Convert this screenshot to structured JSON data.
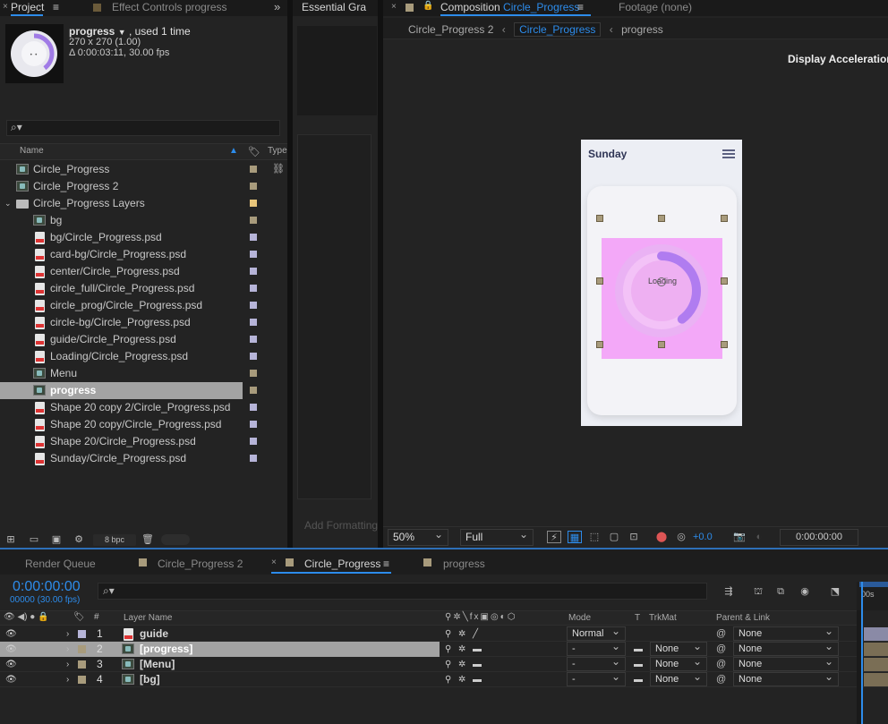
{
  "colors": {
    "accent": "#2d8ceb",
    "bg": "#1c1c1c",
    "panel": "#232323",
    "selection": "#a3a3a3",
    "magenta_layer": "#f3a8f8",
    "progress_arc": "#b07cf0"
  },
  "project_panel": {
    "tab_project": "Project",
    "tab_effect_controls": "Effect Controls progress",
    "item_name": "progress",
    "item_used": ", used 1 time",
    "item_dims": "270 x 270 (1.00)",
    "item_duration": "Δ 0:00:03:11, 30.00 fps",
    "search_placeholder": "",
    "col_name": "Name",
    "col_type": "Type",
    "items": [
      {
        "name": "Circle_Progress",
        "icon": "comp-icon",
        "indent": 0,
        "swatch": "#a89b7c"
      },
      {
        "name": "Circle_Progress 2",
        "icon": "comp-icon",
        "indent": 0,
        "swatch": "#a89b7c"
      },
      {
        "name": "Circle_Progress Layers",
        "icon": "folder-icon",
        "indent": 0,
        "swatch": "#e8c57a"
      },
      {
        "name": "bg",
        "icon": "comp-icon",
        "indent": 1,
        "swatch": "#a89b7c"
      },
      {
        "name": "bg/Circle_Progress.psd",
        "icon": "psd-icon",
        "indent": 1,
        "swatch": "#b6b4d8"
      },
      {
        "name": "card-bg/Circle_Progress.psd",
        "icon": "psd-icon",
        "indent": 1,
        "swatch": "#b6b4d8"
      },
      {
        "name": "center/Circle_Progress.psd",
        "icon": "psd-icon",
        "indent": 1,
        "swatch": "#b6b4d8"
      },
      {
        "name": "circle_full/Circle_Progress.psd",
        "icon": "psd-icon",
        "indent": 1,
        "swatch": "#b6b4d8"
      },
      {
        "name": "circle_prog/Circle_Progress.psd",
        "icon": "psd-icon",
        "indent": 1,
        "swatch": "#b6b4d8"
      },
      {
        "name": "circle-bg/Circle_Progress.psd",
        "icon": "psd-icon",
        "indent": 1,
        "swatch": "#b6b4d8"
      },
      {
        "name": "guide/Circle_Progress.psd",
        "icon": "psd-icon",
        "indent": 1,
        "swatch": "#b6b4d8"
      },
      {
        "name": "Loading/Circle_Progress.psd",
        "icon": "psd-icon",
        "indent": 1,
        "swatch": "#b6b4d8"
      },
      {
        "name": "Menu",
        "icon": "comp-icon",
        "indent": 1,
        "swatch": "#a89b7c"
      },
      {
        "name": "progress",
        "icon": "comp-icon",
        "indent": 1,
        "swatch": "#a89b7c",
        "selected": true
      },
      {
        "name": "Shape 20 copy 2/Circle_Progress.psd",
        "icon": "psd-icon",
        "indent": 1,
        "swatch": "#b6b4d8"
      },
      {
        "name": "Shape 20 copy/Circle_Progress.psd",
        "icon": "psd-icon",
        "indent": 1,
        "swatch": "#b6b4d8"
      },
      {
        "name": "Shape 20/Circle_Progress.psd",
        "icon": "psd-icon",
        "indent": 1,
        "swatch": "#b6b4d8"
      },
      {
        "name": "Sunday/Circle_Progress.psd",
        "icon": "psd-icon",
        "indent": 1,
        "swatch": "#b6b4d8"
      }
    ],
    "bpc": "8 bpc"
  },
  "essential_graphics": {
    "tab": "Essential Gra",
    "add_formatting": "Add Formatting"
  },
  "composition_panel": {
    "tab_prefix": "Composition",
    "tab_name": "Circle_Progress",
    "tab_footage": "Footage (none)",
    "breadcrumbs": [
      "Circle_Progress 2",
      "Circle_Progress",
      "progress"
    ],
    "display_accel": "Display Acceleration D",
    "preview_title": "Sunday",
    "preview_center_text": "Loading",
    "zoom": "50%",
    "resolution": "Full",
    "exposure": "+0.0",
    "timecode": "0:00:00:00",
    "progress_fraction": 0.4
  },
  "timeline_panel": {
    "tabs": [
      "Render Queue",
      "Circle_Progress 2",
      "Circle_Progress",
      "progress"
    ],
    "timecode": "0:00:00:00",
    "frames_fps": "00000 (30.00 fps)",
    "headers": {
      "layer_name": "Layer Name",
      "mode": "Mode",
      "t": "T",
      "trkmat": "TrkMat",
      "parent": "Parent & Link",
      "ruler": "00s"
    },
    "layers": [
      {
        "num": "1",
        "name": "guide",
        "mode": "Normal",
        "trkmat": "",
        "parent": "None",
        "swatch": "#b6b4d8",
        "icon": "psd-icon"
      },
      {
        "num": "2",
        "name": "[progress]",
        "mode": "-",
        "trkmat": "None",
        "parent": "None",
        "swatch": "#a89b7c",
        "icon": "comp-icon",
        "selected": true
      },
      {
        "num": "3",
        "name": "[Menu]",
        "mode": "-",
        "trkmat": "None",
        "parent": "None",
        "swatch": "#a89b7c",
        "icon": "comp-icon"
      },
      {
        "num": "4",
        "name": "[bg]",
        "mode": "-",
        "trkmat": "None",
        "parent": "None",
        "swatch": "#a89b7c",
        "icon": "comp-icon"
      }
    ]
  }
}
